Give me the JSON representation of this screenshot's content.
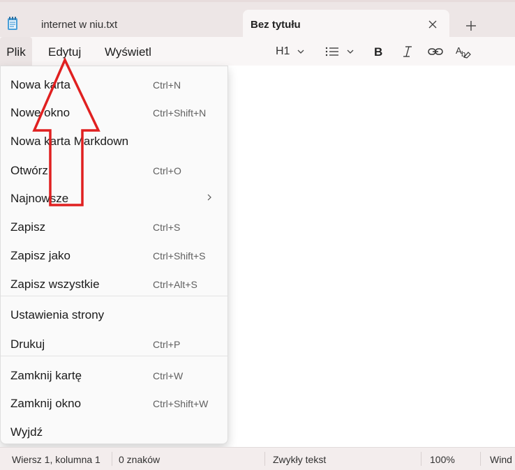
{
  "tabs": [
    {
      "label": "internet w niu.txt",
      "active": false
    },
    {
      "label": "Bez tytułu",
      "active": true
    }
  ],
  "menubar": {
    "plik": "Plik",
    "edytuj": "Edytuj",
    "wyswietl": "Wyświetl"
  },
  "format": {
    "heading": "H1"
  },
  "file_menu": [
    {
      "label": "Nowa karta",
      "shortcut": "Ctrl+N"
    },
    {
      "label": "Nowe okno",
      "shortcut": "Ctrl+Shift+N"
    },
    {
      "label": "Nowa karta Markdown",
      "shortcut": ""
    },
    {
      "label": "Otwórz",
      "shortcut": "Ctrl+O"
    },
    {
      "label": "Najnowsze",
      "shortcut": "",
      "submenu": true
    },
    {
      "label": "Zapisz",
      "shortcut": "Ctrl+S"
    },
    {
      "label": "Zapisz jako",
      "shortcut": "Ctrl+Shift+S"
    },
    {
      "label": "Zapisz wszystkie",
      "shortcut": "Ctrl+Alt+S"
    },
    {
      "label": "Ustawienia strony",
      "shortcut": ""
    },
    {
      "label": "Drukuj",
      "shortcut": "Ctrl+P"
    },
    {
      "label": "Zamknij kartę",
      "shortcut": "Ctrl+W"
    },
    {
      "label": "Zamknij okno",
      "shortcut": "Ctrl+Shift+W"
    },
    {
      "label": "Wyjdź",
      "shortcut": ""
    }
  ],
  "statusbar": {
    "position": "Wiersz 1, kolumna 1",
    "chars": "0 znaków",
    "format": "Zwykły tekst",
    "zoom": "100%",
    "encoding": "Wind"
  },
  "colors": {
    "annotation_arrow": "#e02020",
    "tabbar_bg": "#ede6e6",
    "menu_bg": "#fafafa"
  }
}
